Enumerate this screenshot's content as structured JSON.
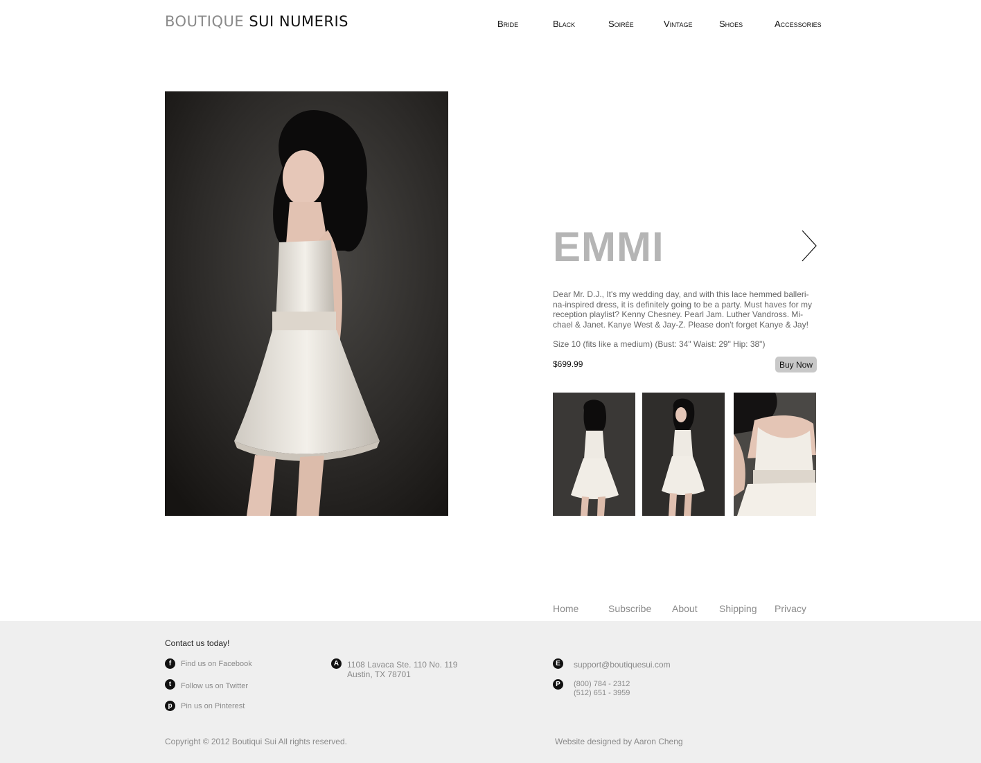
{
  "header": {
    "logo_light": "BOUTIQUE",
    "logo_dark": "SUI NUMERIS",
    "nav": [
      "Bride",
      "Black",
      "Soirée",
      "Vintage",
      "Shoes",
      "Accessories"
    ]
  },
  "product": {
    "name": "EMMI",
    "description": "Dear Mr. D.J., It's my wedding day, and with this lace hemmed balleri-na-inspired dress, it is definitely going to be a party. Must haves for my reception playlist? Kenny Chesney. Pearl Jam. Luther Vandross. Mi-chael & Janet. Kanye West & Jay-Z. Please don't forget Kanye & Jay!",
    "size": "Size 10 (fits like a medium) (Bust: 34\" Waist: 29\" Hip: 38\")",
    "price": "$699.99",
    "buy_label": "Buy Now",
    "next_icon": "chevron-right-icon"
  },
  "footer_nav": [
    "Home",
    "Subscribe",
    "About",
    "Shipping",
    "Privacy"
  ],
  "footer": {
    "contact_title": "Contact us today!",
    "social": [
      {
        "icon": "facebook-icon",
        "label": "Find us on Facebook"
      },
      {
        "icon": "twitter-icon",
        "label": "Follow us on Twitter"
      },
      {
        "icon": "pinterest-icon",
        "label": "Pin us on Pinterest"
      }
    ],
    "address_line1": "1108 Lavaca Ste. 110 No. 119",
    "address_line2": "Austin, TX 78701",
    "email": "support@boutiquesui.com",
    "phone1": "(800) 784 - 2312",
    "phone2": "(512) 651 - 3959",
    "copyright": "Copyright © 2012 Boutiqui Sui All rights reserved.",
    "designed_by": "Website designed by  Aaron Cheng"
  },
  "colors": {
    "title_grey": "#b5b5b5",
    "button_bg": "#c8c8c8",
    "footer_bg": "#efefef"
  }
}
